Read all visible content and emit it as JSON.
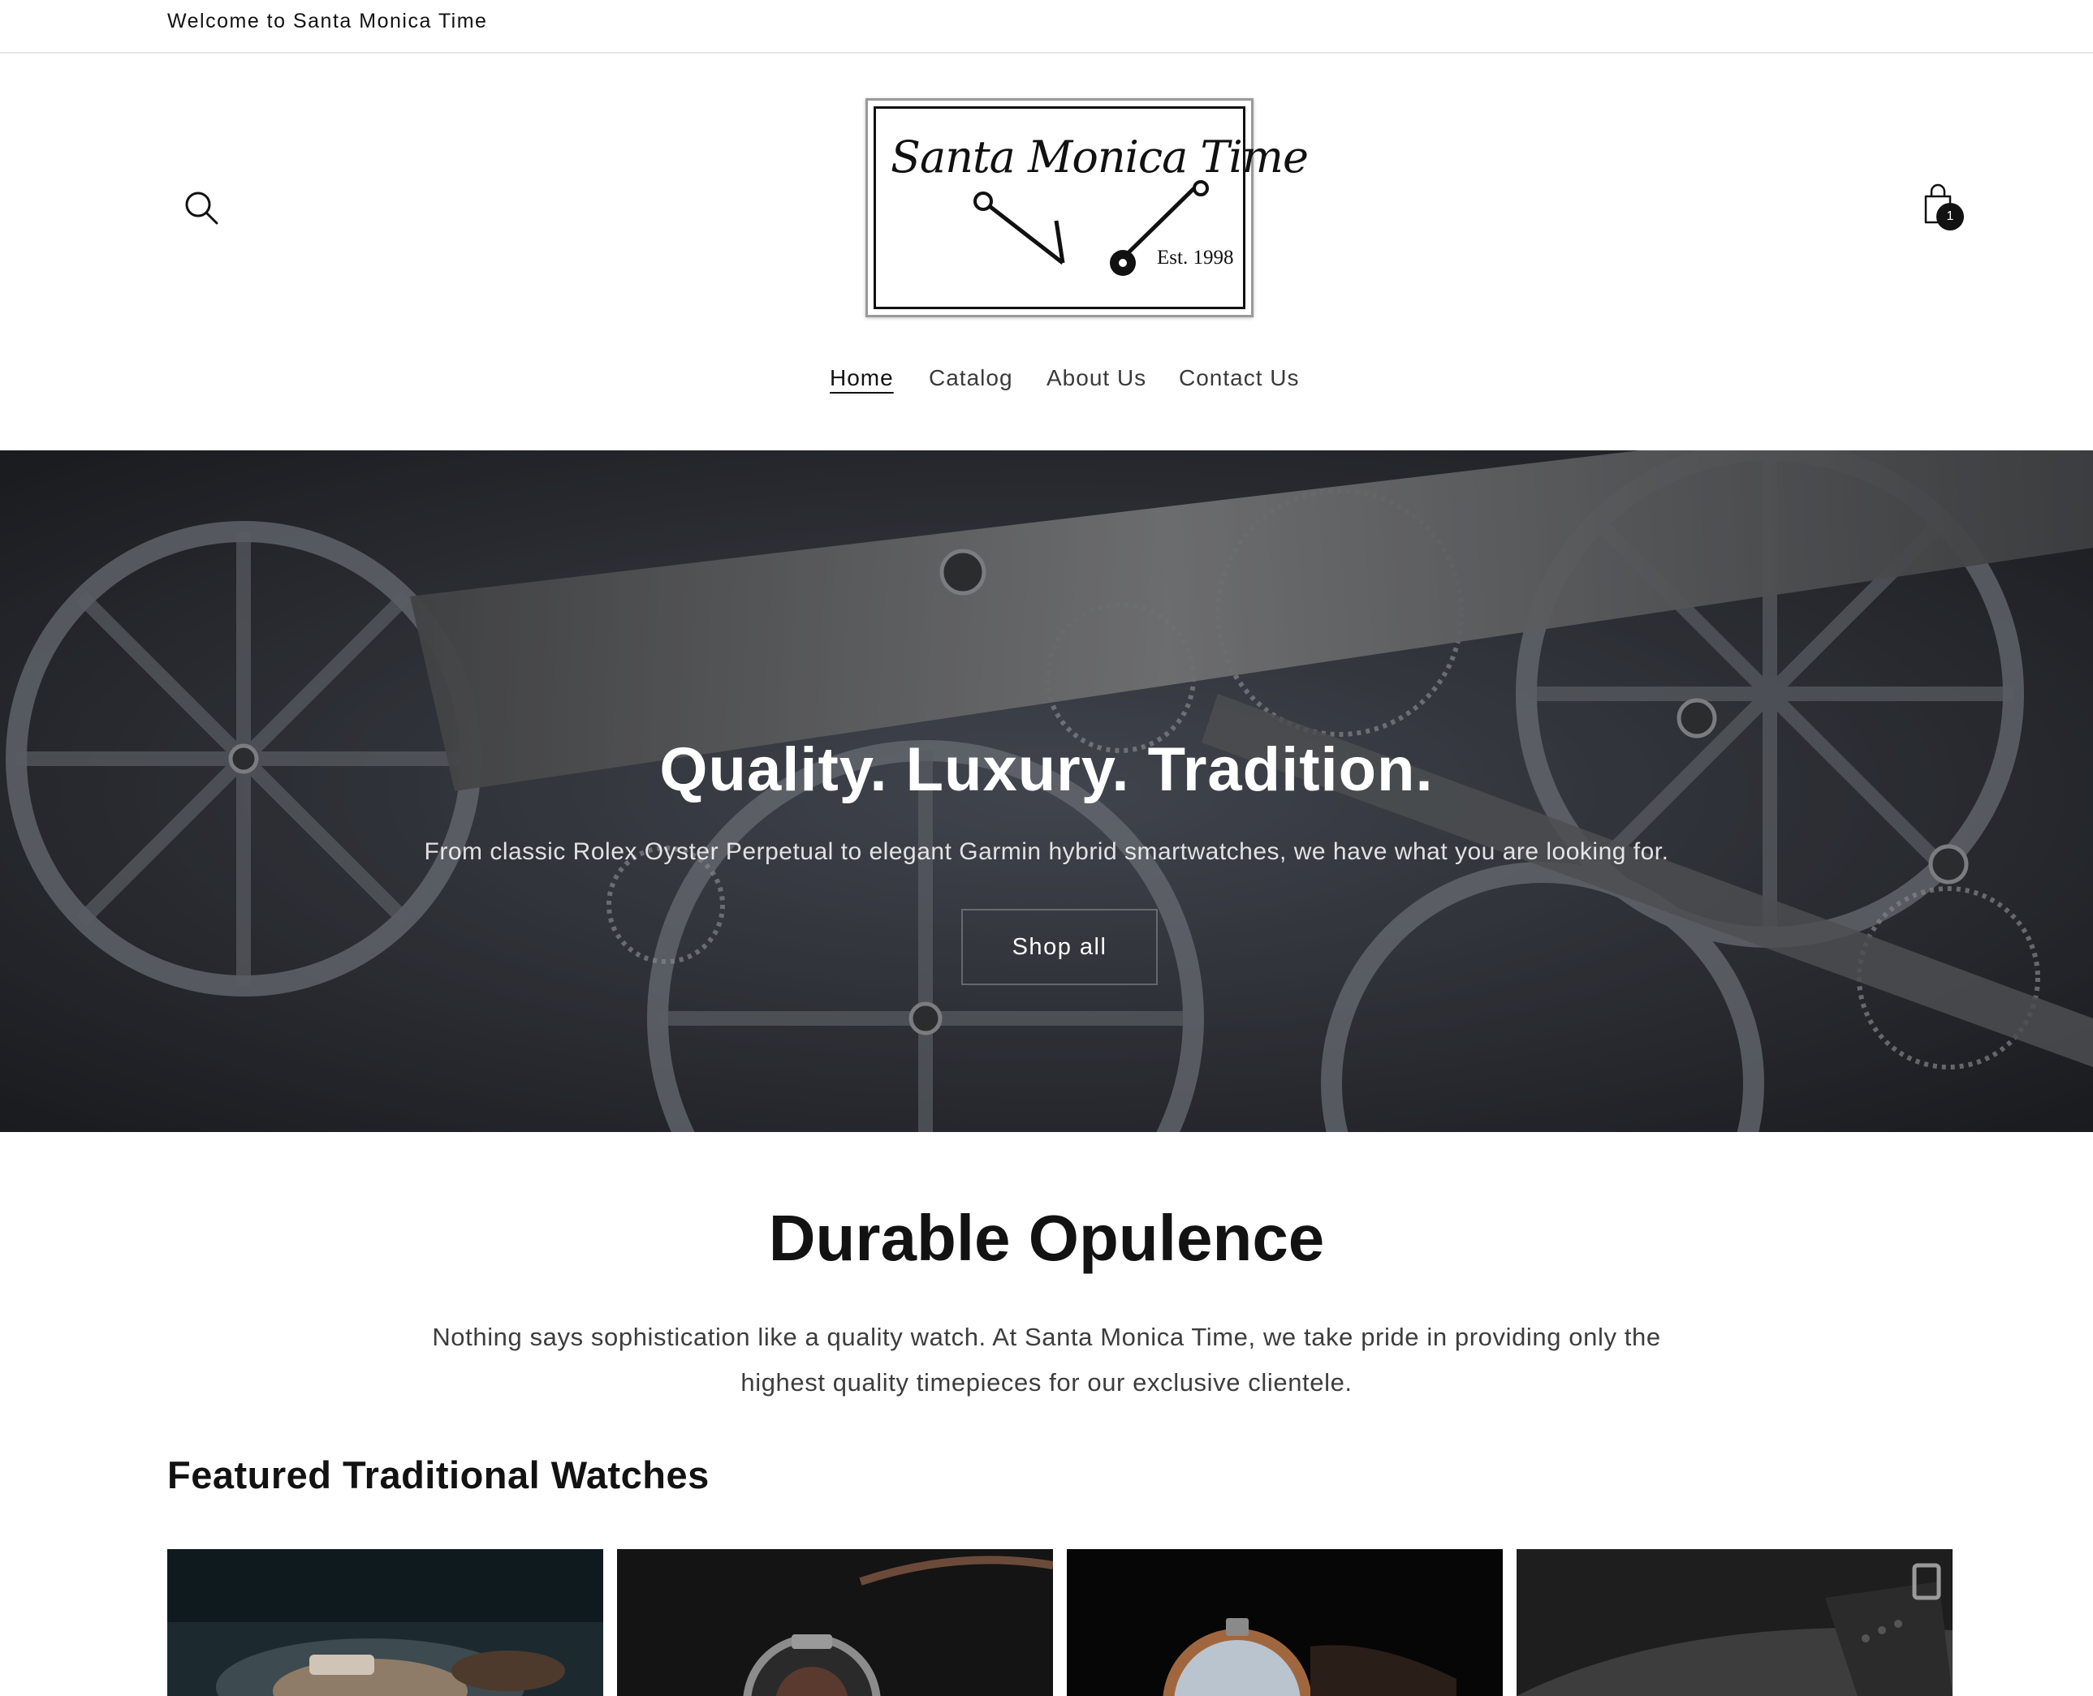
{
  "announcement": {
    "text": "Welcome to Santa Monica Time"
  },
  "header": {
    "logo": {
      "name": "Santa Monica Time",
      "est": "Est. 1998"
    },
    "cart": {
      "count": "1"
    },
    "icons": {
      "search": "search-icon",
      "cart": "cart-icon"
    }
  },
  "nav": {
    "items": [
      {
        "label": "Home",
        "active": true
      },
      {
        "label": "Catalog"
      },
      {
        "label": "About Us"
      },
      {
        "label": "Contact Us"
      }
    ]
  },
  "hero": {
    "title": "Quality. Luxury. Tradition.",
    "subtitle": "From classic Rolex Oyster Perpetual to elegant Garmin hybrid smartwatches, we have what you are looking for.",
    "button_label": "Shop all"
  },
  "intro": {
    "title": "Durable Opulence",
    "text": "Nothing says sophistication like a quality watch. At Santa Monica Time, we take pride in providing only the highest quality timepieces for our exclusive clientele."
  },
  "featured": {
    "title": "Featured Traditional Watches",
    "products": [
      {
        "image": "watch-photo-1"
      },
      {
        "image": "watch-photo-2"
      },
      {
        "image": "watch-photo-3"
      },
      {
        "image": "watch-photo-4"
      }
    ]
  },
  "colors": {
    "text": "#121212",
    "background": "#ffffff",
    "badge": "#121212"
  }
}
